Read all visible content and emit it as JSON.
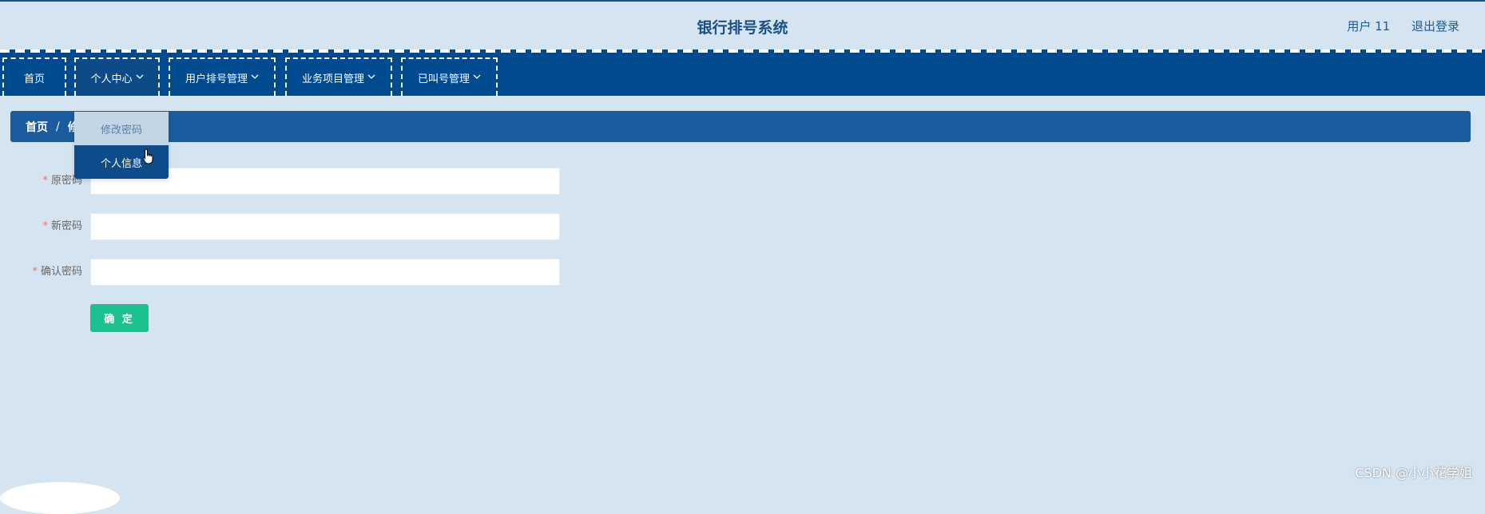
{
  "header": {
    "title": "银行排号系统",
    "user": "用户 11",
    "logout": "退出登录"
  },
  "nav": {
    "items": [
      {
        "label": "首页",
        "has_dropdown": false
      },
      {
        "label": "个人中心",
        "has_dropdown": true
      },
      {
        "label": "用户排号管理",
        "has_dropdown": true
      },
      {
        "label": "业务项目管理",
        "has_dropdown": true
      },
      {
        "label": "已叫号管理",
        "has_dropdown": true
      }
    ]
  },
  "breadcrumb": {
    "home": "首页",
    "separator": "/",
    "current": "修"
  },
  "dropdown": {
    "items": [
      {
        "label": "修改密码"
      },
      {
        "label": "个人信息"
      }
    ]
  },
  "form": {
    "required_mark": "*",
    "fields": [
      {
        "label": "原密码",
        "value": ""
      },
      {
        "label": "新密码",
        "value": ""
      },
      {
        "label": "确认密码",
        "value": ""
      }
    ],
    "submit": "确 定"
  },
  "watermark": "CSDN @小小花学姐",
  "colors": {
    "navbar": "#004a8f",
    "breadcrumb": "#1a5c9d",
    "background": "#d4e4f1",
    "confirm": "#19c28e"
  }
}
